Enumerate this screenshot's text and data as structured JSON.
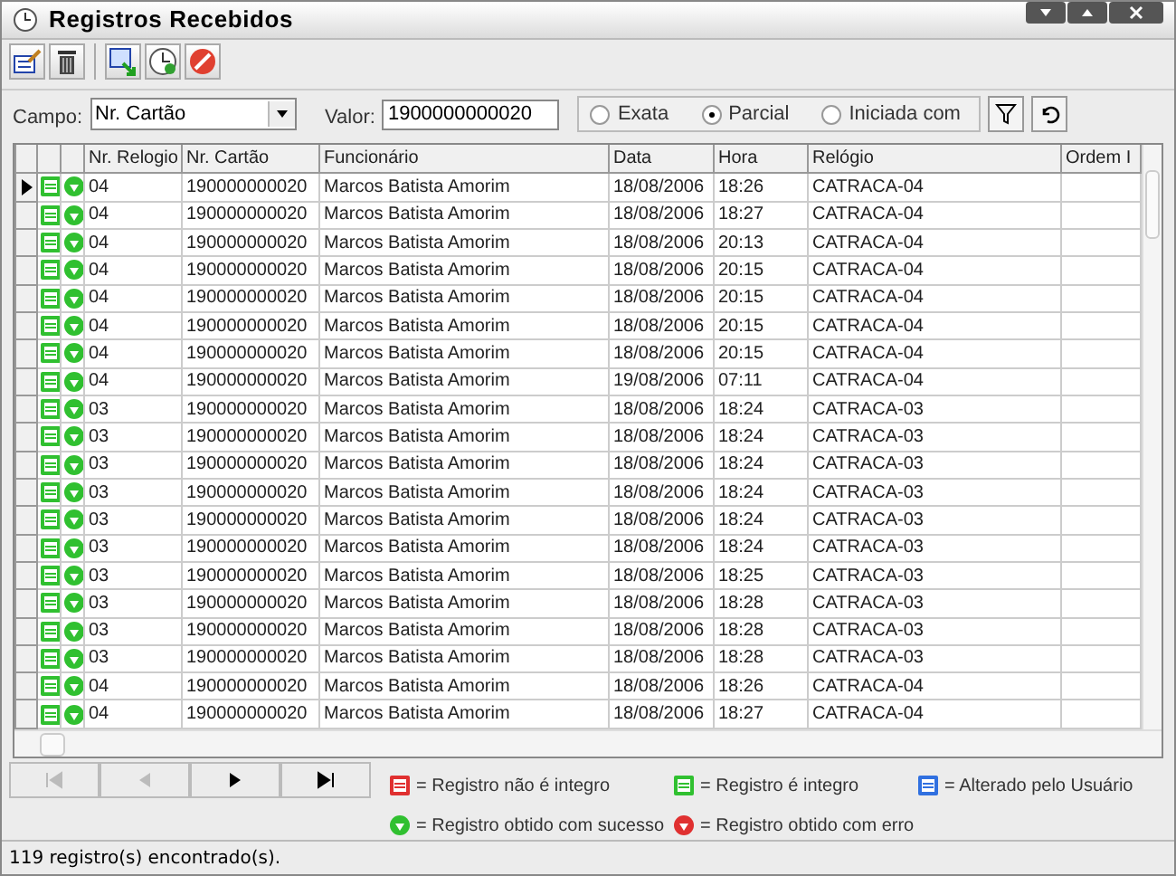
{
  "window": {
    "title": "Registros Recebidos"
  },
  "toolbar": [
    {
      "kind": "edit"
    },
    {
      "kind": "delete"
    },
    {
      "kind": "export"
    },
    {
      "kind": "clock"
    },
    {
      "kind": "stop"
    }
  ],
  "filter": {
    "field_label": "Campo:",
    "field_value": "Nr. Cartão",
    "value_label": "Valor:",
    "value": "1900000000020",
    "options": [
      {
        "label": "Exata",
        "selected": false
      },
      {
        "label": "Parcial",
        "selected": true
      },
      {
        "label": "Iniciada com",
        "selected": false
      }
    ]
  },
  "table": {
    "columns": [
      "Nr. Relogio",
      "Nr. Cartão",
      "Funcionário",
      "Data",
      "Hora",
      "Relógio",
      "Ordem I"
    ],
    "rows": [
      {
        "selected": true,
        "cells": [
          "04",
          "190000000020",
          "Marcos Batista Amorim",
          "18/08/2006",
          "18:26",
          "CATRACA-04",
          ""
        ]
      },
      {
        "selected": false,
        "cells": [
          "04",
          "190000000020",
          "Marcos Batista Amorim",
          "18/08/2006",
          "18:27",
          "CATRACA-04",
          ""
        ]
      },
      {
        "selected": false,
        "cells": [
          "04",
          "190000000020",
          "Marcos Batista Amorim",
          "18/08/2006",
          "20:13",
          "CATRACA-04",
          ""
        ]
      },
      {
        "selected": false,
        "cells": [
          "04",
          "190000000020",
          "Marcos Batista Amorim",
          "18/08/2006",
          "20:15",
          "CATRACA-04",
          ""
        ]
      },
      {
        "selected": false,
        "cells": [
          "04",
          "190000000020",
          "Marcos Batista Amorim",
          "18/08/2006",
          "20:15",
          "CATRACA-04",
          ""
        ]
      },
      {
        "selected": false,
        "cells": [
          "04",
          "190000000020",
          "Marcos Batista Amorim",
          "18/08/2006",
          "20:15",
          "CATRACA-04",
          ""
        ]
      },
      {
        "selected": false,
        "cells": [
          "04",
          "190000000020",
          "Marcos Batista Amorim",
          "18/08/2006",
          "20:15",
          "CATRACA-04",
          ""
        ]
      },
      {
        "selected": false,
        "cells": [
          "04",
          "190000000020",
          "Marcos Batista Amorim",
          "19/08/2006",
          "07:11",
          "CATRACA-04",
          ""
        ]
      },
      {
        "selected": false,
        "cells": [
          "03",
          "190000000020",
          "Marcos Batista Amorim",
          "18/08/2006",
          "18:24",
          "CATRACA-03",
          ""
        ]
      },
      {
        "selected": false,
        "cells": [
          "03",
          "190000000020",
          "Marcos Batista Amorim",
          "18/08/2006",
          "18:24",
          "CATRACA-03",
          ""
        ]
      },
      {
        "selected": false,
        "cells": [
          "03",
          "190000000020",
          "Marcos Batista Amorim",
          "18/08/2006",
          "18:24",
          "CATRACA-03",
          ""
        ]
      },
      {
        "selected": false,
        "cells": [
          "03",
          "190000000020",
          "Marcos Batista Amorim",
          "18/08/2006",
          "18:24",
          "CATRACA-03",
          ""
        ]
      },
      {
        "selected": false,
        "cells": [
          "03",
          "190000000020",
          "Marcos Batista Amorim",
          "18/08/2006",
          "18:24",
          "CATRACA-03",
          ""
        ]
      },
      {
        "selected": false,
        "cells": [
          "03",
          "190000000020",
          "Marcos Batista Amorim",
          "18/08/2006",
          "18:24",
          "CATRACA-03",
          ""
        ]
      },
      {
        "selected": false,
        "cells": [
          "03",
          "190000000020",
          "Marcos Batista Amorim",
          "18/08/2006",
          "18:25",
          "CATRACA-03",
          ""
        ]
      },
      {
        "selected": false,
        "cells": [
          "03",
          "190000000020",
          "Marcos Batista Amorim",
          "18/08/2006",
          "18:28",
          "CATRACA-03",
          ""
        ]
      },
      {
        "selected": false,
        "cells": [
          "03",
          "190000000020",
          "Marcos Batista Amorim",
          "18/08/2006",
          "18:28",
          "CATRACA-03",
          ""
        ]
      },
      {
        "selected": false,
        "cells": [
          "03",
          "190000000020",
          "Marcos Batista Amorim",
          "18/08/2006",
          "18:28",
          "CATRACA-03",
          ""
        ]
      },
      {
        "selected": false,
        "cells": [
          "04",
          "190000000020",
          "Marcos Batista Amorim",
          "18/08/2006",
          "18:26",
          "CATRACA-04",
          ""
        ]
      },
      {
        "selected": false,
        "cells": [
          "04",
          "190000000020",
          "Marcos Batista Amorim",
          "18/08/2006",
          "18:27",
          "CATRACA-04",
          ""
        ]
      }
    ]
  },
  "navigation": [
    {
      "kind": "first",
      "disabled": true
    },
    {
      "kind": "prev",
      "disabled": true
    },
    {
      "kind": "next",
      "disabled": false
    },
    {
      "kind": "last",
      "disabled": false
    }
  ],
  "legend": [
    {
      "kind": "sheet",
      "color": "#e03030",
      "label": "= Registro não é integro"
    },
    {
      "kind": "sheet",
      "color": "#30c030",
      "label": "= Registro é integro"
    },
    {
      "kind": "sheet",
      "color": "#3070e0",
      "label": "= Alterado pelo Usuário"
    },
    {
      "kind": "circle",
      "color": "#30c030",
      "label": "= Registro obtido com sucesso"
    },
    {
      "kind": "circle",
      "color": "#e03030",
      "label": "= Registro obtido com erro"
    }
  ],
  "status_bar": "119 registro(s) encontrado(s)."
}
